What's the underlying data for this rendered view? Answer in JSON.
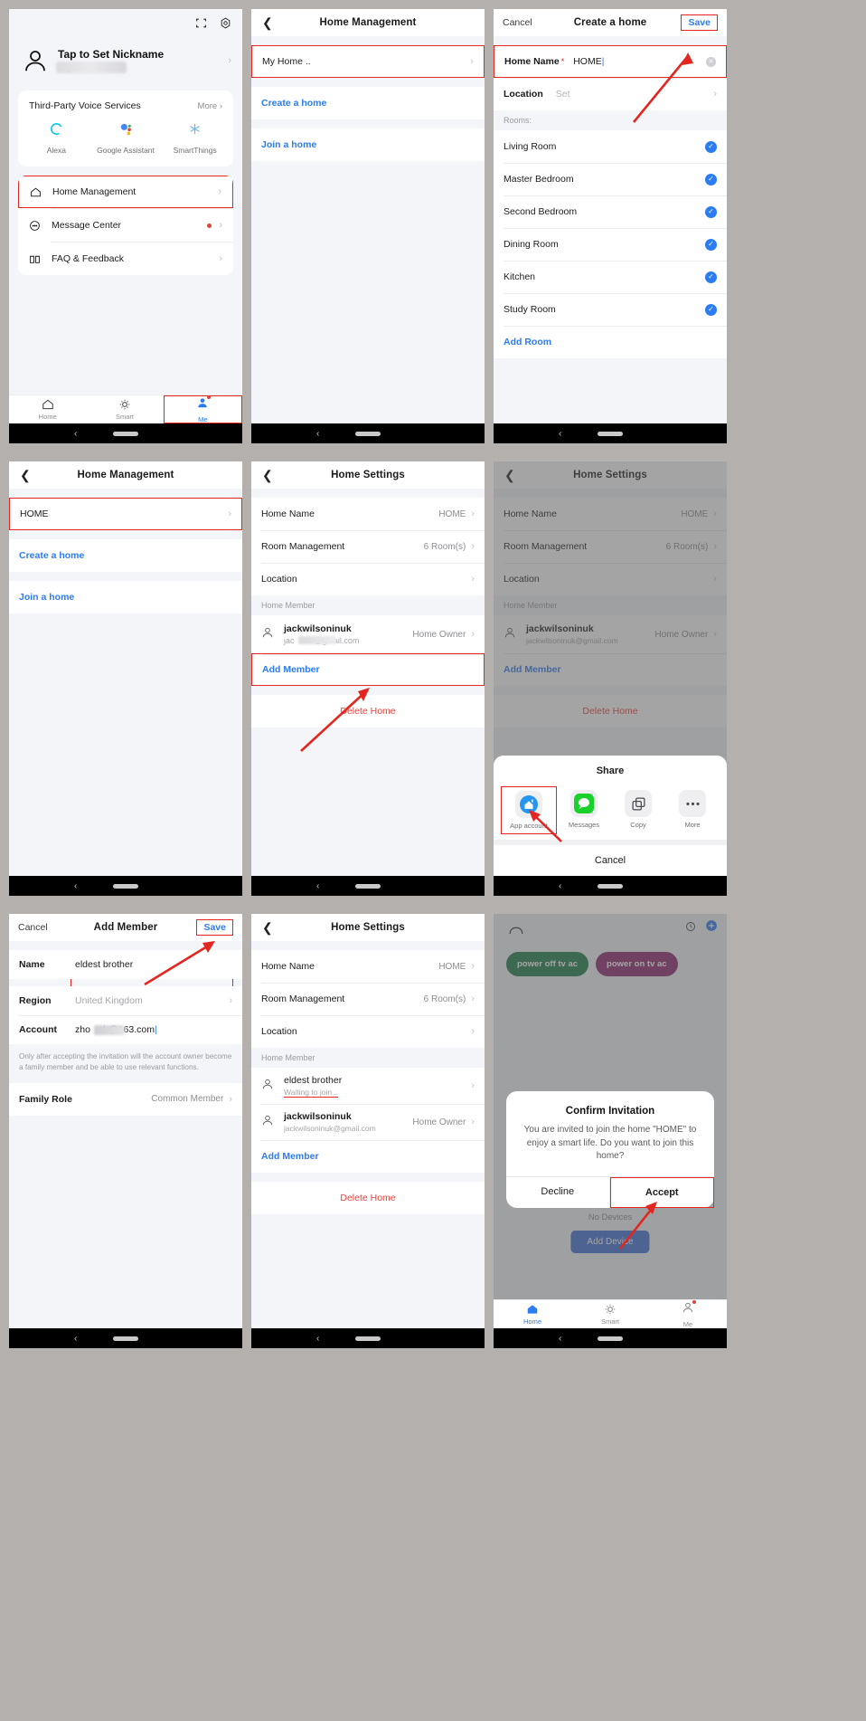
{
  "panels": {
    "me": {
      "profile_name": "Tap to Set Nickname",
      "profile_email": "@gmail.com",
      "scan_icon": "scan-icon",
      "settings_icon": "gear-icon",
      "voice_card": {
        "title": "Third-Party Voice Services",
        "more": "More",
        "items": [
          {
            "name": "Alexa",
            "icon": "alexa-icon"
          },
          {
            "name": "Google Assistant",
            "icon": "google-assistant-icon"
          },
          {
            "name": "SmartThings",
            "icon": "smartthings-icon"
          }
        ]
      },
      "menu": [
        {
          "label": "Home Management",
          "icon": "house-icon",
          "highlighted": true
        },
        {
          "label": "Message Center",
          "icon": "message-icon",
          "badge": true
        },
        {
          "label": "FAQ & Feedback",
          "icon": "book-icon",
          "badge": false
        }
      ],
      "tabs": [
        {
          "label": "Home",
          "icon": "home-icon",
          "active": false
        },
        {
          "label": "Smart",
          "icon": "smart-icon",
          "active": false
        },
        {
          "label": "Me",
          "icon": "me-icon",
          "active": true
        }
      ]
    },
    "home_management_1": {
      "title": "Home Management",
      "home_row": "My Home ..",
      "create": "Create a home",
      "join": "Join a home"
    },
    "create_home": {
      "cancel": "Cancel",
      "title": "Create a home",
      "save": "Save",
      "home_name_label": "Home Name",
      "home_name_required": "*",
      "home_name_value": "HOME",
      "location_label": "Location",
      "location_value": "Set",
      "rooms_header": "Rooms:",
      "rooms": [
        "Living Room",
        "Master Bedroom",
        "Second Bedroom",
        "Dining Room",
        "Kitchen",
        "Study Room"
      ],
      "add_room": "Add Room"
    },
    "home_management_2": {
      "title": "Home Management",
      "home_row": "HOME",
      "create": "Create a home",
      "join": "Join a home"
    },
    "home_settings_1": {
      "title": "Home Settings",
      "rows": [
        {
          "label": "Home Name",
          "value": "HOME"
        },
        {
          "label": "Room Management",
          "value": "6 Room(s)"
        },
        {
          "label": "Location",
          "value": ""
        }
      ],
      "member_header": "Home Member",
      "members": [
        {
          "name": "jackwilsoninuk",
          "email": "jac    nuk@gmail.com",
          "role": "Home Owner"
        }
      ],
      "add_member": "Add Member",
      "delete_home": "Delete Home"
    },
    "home_settings_share": {
      "title": "Home Settings",
      "rows": [
        {
          "label": "Home Name",
          "value": "HOME"
        },
        {
          "label": "Room Management",
          "value": "6 Room(s)"
        },
        {
          "label": "Location",
          "value": ""
        }
      ],
      "member_header": "Home Member",
      "members": [
        {
          "name": "jackwilsoninuk",
          "email": "jackwilsoninuk@gmail.com",
          "role": "Home Owner"
        }
      ],
      "add_member": "Add Member",
      "delete_home": "Delete Home",
      "share": {
        "title": "Share",
        "items": [
          {
            "name": "App account",
            "icon": "app-account-icon"
          },
          {
            "name": "Messages",
            "icon": "messages-icon"
          },
          {
            "name": "Copy",
            "icon": "copy-icon"
          },
          {
            "name": "More",
            "icon": "more-icon"
          }
        ],
        "cancel": "Cancel"
      }
    },
    "add_member": {
      "cancel": "Cancel",
      "title": "Add Member",
      "save": "Save",
      "fields": [
        {
          "label": "Name",
          "value": "eldest brother"
        },
        {
          "label": "Region",
          "value": "United Kingdom"
        },
        {
          "label": "Account",
          "value": "zho    ub@163.com"
        }
      ],
      "note": "Only after accepting the invitation will the account owner become a family member and be able to use relevant functions.",
      "family_role_label": "Family Role",
      "family_role_value": "Common Member"
    },
    "home_settings_2": {
      "title": "Home Settings",
      "rows": [
        {
          "label": "Home Name",
          "value": "HOME"
        },
        {
          "label": "Room Management",
          "value": "6 Room(s)"
        },
        {
          "label": "Location",
          "value": ""
        }
      ],
      "member_header": "Home Member",
      "members": [
        {
          "name": "eldest brother",
          "email": "Waiting to join...",
          "role": ""
        },
        {
          "name": "jackwilsoninuk",
          "email": "jackwilsoninuk@gmail.com",
          "role": "Home Owner"
        }
      ],
      "add_member": "Add Member",
      "delete_home": "Delete Home"
    },
    "confirm_invitation": {
      "bubbles": [
        {
          "text": "power off tv ac",
          "color": "#1b7a4a"
        },
        {
          "text": "power on tv ac",
          "color": "#8e2472"
        }
      ],
      "no_devices": "No Devices",
      "add_device": "Add Device",
      "dialog": {
        "title": "Confirm Invitation",
        "message": "You are invited to join the home \"HOME\" to enjoy a smart life. Do you want to join this home?",
        "decline": "Decline",
        "accept": "Accept"
      },
      "tabs": [
        {
          "label": "Home",
          "icon": "home-icon",
          "active": true
        },
        {
          "label": "Smart",
          "icon": "smart-icon",
          "active": false
        },
        {
          "label": "Me",
          "icon": "me-icon",
          "active": false
        }
      ]
    }
  },
  "colors": {
    "accent": "#2b7bf3",
    "highlight": "#e3261f",
    "danger": "#e8413a",
    "bg": "#f4f5f8"
  }
}
